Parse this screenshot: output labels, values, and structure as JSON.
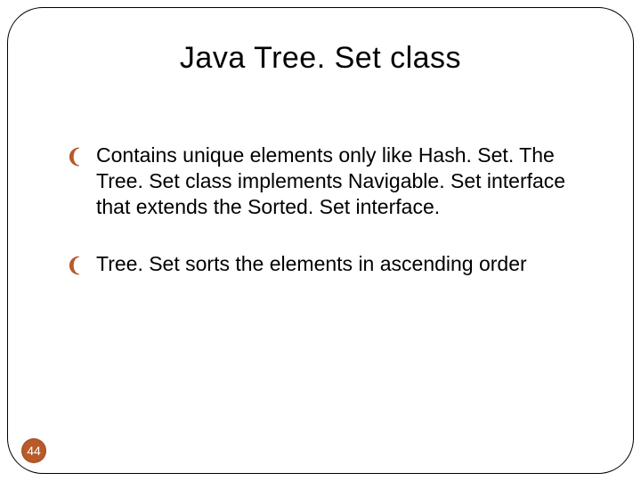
{
  "slide": {
    "title": "Java Tree. Set class",
    "bullets": [
      "Contains unique elements only like Hash. Set. The Tree. Set class implements Navigable. Set interface that extends the Sorted. Set interface.",
      "Tree. Set sorts the elements in ascending order"
    ],
    "bullet_glyph": "",
    "page_number": "44"
  }
}
